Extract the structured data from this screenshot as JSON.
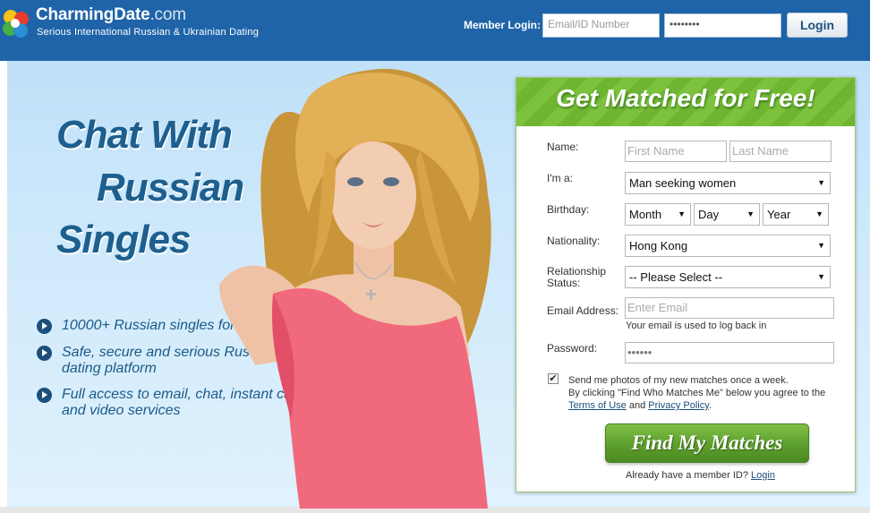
{
  "header": {
    "brand_name": "CharmingDate",
    "brand_domain": ".com",
    "tagline": "Serious International Russian & Ukrainian Dating",
    "member_login_label": "Member Login:",
    "email_placeholder": "Email/ID Number",
    "password_value": "••••••••",
    "login_button": "Login"
  },
  "hero": {
    "headline": [
      "Chat With",
      "Russian",
      "Singles"
    ],
    "bullets": [
      "10000+ Russian singles for you",
      "Safe, secure and serious Russian dating platform",
      "Full access to email, chat, instant call and video services"
    ]
  },
  "form": {
    "title": "Get Matched for Free!",
    "name_label": "Name:",
    "first_name_placeholder": "First Name",
    "last_name_placeholder": "Last Name",
    "iam_label": "I'm a:",
    "iam_value": "Man seeking women",
    "birthday_label": "Birthday:",
    "month_value": "Month",
    "day_value": "Day",
    "year_value": "Year",
    "nationality_label": "Nationality:",
    "nationality_value": "Hong Kong",
    "relationship_label_1": "Relationship",
    "relationship_label_2": "Status:",
    "relationship_value": "-- Please Select --",
    "email_label": "Email Address:",
    "email_placeholder": "Enter Email",
    "email_hint": "Your email is used to log back in",
    "password_label": "Password:",
    "password_value": "••••••",
    "consent_line1": "Send me photos of my new matches once a week.",
    "consent_line2": "By clicking \"Find Who Matches Me\" below you agree to the",
    "terms_link": "Terms of Use",
    "and_text": "and",
    "privacy_link": "Privacy Policy",
    "period": ".",
    "submit_button": "Find My Matches",
    "already_text": "Already have a member ID?",
    "login_link": "Login"
  },
  "colors": {
    "header_bg": "#1f64a8",
    "headline": "#1d5f8e",
    "form_head_green": "#7cc23c",
    "button_green": "#5c9e2d"
  },
  "icons": [
    "charmingdate-logo-icon",
    "checkmark-icon",
    "play-bullet-icon",
    "dropdown-arrow-icon"
  ]
}
